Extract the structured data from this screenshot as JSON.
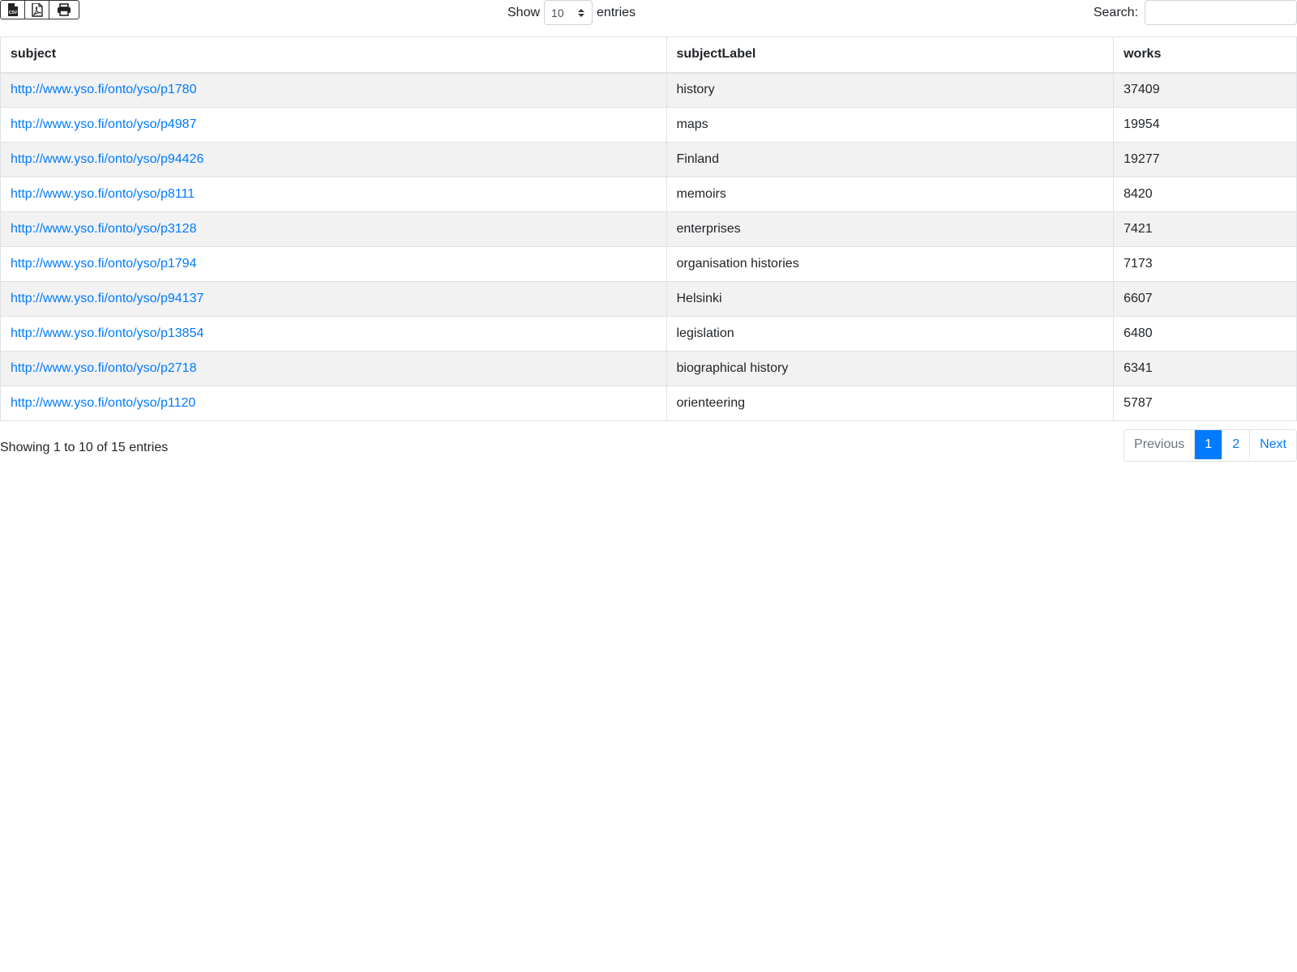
{
  "toolbar": {
    "export_icons": [
      "csv-file-icon",
      "pdf-file-icon",
      "print-icon"
    ],
    "csv_glyph_text": "CSV"
  },
  "length_menu": {
    "show_label": "Show",
    "selected_value": "10",
    "entries_label": "entries"
  },
  "search": {
    "label": "Search:",
    "value": ""
  },
  "table": {
    "columns": [
      "subject",
      "subjectLabel",
      "works"
    ],
    "rows": [
      {
        "subject": "http://www.yso.fi/onto/yso/p1780",
        "subjectLabel": "history",
        "works": "37409"
      },
      {
        "subject": "http://www.yso.fi/onto/yso/p4987",
        "subjectLabel": "maps",
        "works": "19954"
      },
      {
        "subject": "http://www.yso.fi/onto/yso/p94426",
        "subjectLabel": "Finland",
        "works": "19277"
      },
      {
        "subject": "http://www.yso.fi/onto/yso/p8111",
        "subjectLabel": "memoirs",
        "works": "8420"
      },
      {
        "subject": "http://www.yso.fi/onto/yso/p3128",
        "subjectLabel": "enterprises",
        "works": "7421"
      },
      {
        "subject": "http://www.yso.fi/onto/yso/p1794",
        "subjectLabel": "organisation histories",
        "works": "7173"
      },
      {
        "subject": "http://www.yso.fi/onto/yso/p94137",
        "subjectLabel": "Helsinki",
        "works": "6607"
      },
      {
        "subject": "http://www.yso.fi/onto/yso/p13854",
        "subjectLabel": "legislation",
        "works": "6480"
      },
      {
        "subject": "http://www.yso.fi/onto/yso/p2718",
        "subjectLabel": "biographical history",
        "works": "6341"
      },
      {
        "subject": "http://www.yso.fi/onto/yso/p1120",
        "subjectLabel": "orienteering",
        "works": "5787"
      }
    ]
  },
  "info": {
    "text": "Showing 1 to 10 of 15 entries"
  },
  "pagination": {
    "previous": "Previous",
    "pages": [
      "1",
      "2"
    ],
    "active_page": "1",
    "next": "Next"
  },
  "colors": {
    "link": "#007bff",
    "active_page_bg": "#007bff",
    "striped_row_bg": "#f2f2f2"
  }
}
